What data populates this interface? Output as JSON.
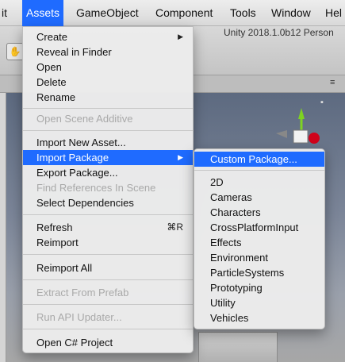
{
  "menubar": {
    "items": [
      "it",
      "Assets",
      "GameObject",
      "Component",
      "Tools",
      "Window",
      "Hel"
    ],
    "active_index": 1
  },
  "editor": {
    "version_label": "Unity 2018.1.0b12 Person",
    "hand_tool_glyph": "✋"
  },
  "assets_menu": {
    "items": [
      {
        "label": "Create",
        "enabled": true,
        "submenu": true
      },
      {
        "label": "Reveal in Finder",
        "enabled": true
      },
      {
        "label": "Open",
        "enabled": true
      },
      {
        "label": "Delete",
        "enabled": true
      },
      {
        "label": "Rename",
        "enabled": true
      },
      {
        "label": "Open Scene Additive",
        "enabled": false
      },
      {
        "label": "Import New Asset...",
        "enabled": true
      },
      {
        "label": "Import Package",
        "enabled": true,
        "submenu": true,
        "highlighted": true
      },
      {
        "label": "Export Package...",
        "enabled": true
      },
      {
        "label": "Find References In Scene",
        "enabled": false
      },
      {
        "label": "Select Dependencies",
        "enabled": true
      },
      {
        "label": "Refresh",
        "enabled": true,
        "shortcut": "⌘R"
      },
      {
        "label": "Reimport",
        "enabled": true
      },
      {
        "label": "Reimport All",
        "enabled": true
      },
      {
        "label": "Extract From Prefab",
        "enabled": false
      },
      {
        "label": "Run API Updater...",
        "enabled": false
      },
      {
        "label": "Open C# Project",
        "enabled": true
      }
    ]
  },
  "package_menu": {
    "items": [
      {
        "label": "Custom Package...",
        "highlighted": true
      },
      {
        "label": "2D"
      },
      {
        "label": "Cameras"
      },
      {
        "label": "Characters"
      },
      {
        "label": "CrossPlatformInput"
      },
      {
        "label": "Effects"
      },
      {
        "label": "Environment"
      },
      {
        "label": "ParticleSystems"
      },
      {
        "label": "Prototyping"
      },
      {
        "label": "Utility"
      },
      {
        "label": "Vehicles"
      }
    ]
  },
  "icons": {
    "submenu_arrow": "▶",
    "lock": "🔒",
    "panel_menu": "≡"
  },
  "colors": {
    "highlight": "#1f6bff",
    "disabled_text": "#a9a9a9",
    "gizmo_y": "#7ed321",
    "gizmo_x": "#d0021b"
  }
}
